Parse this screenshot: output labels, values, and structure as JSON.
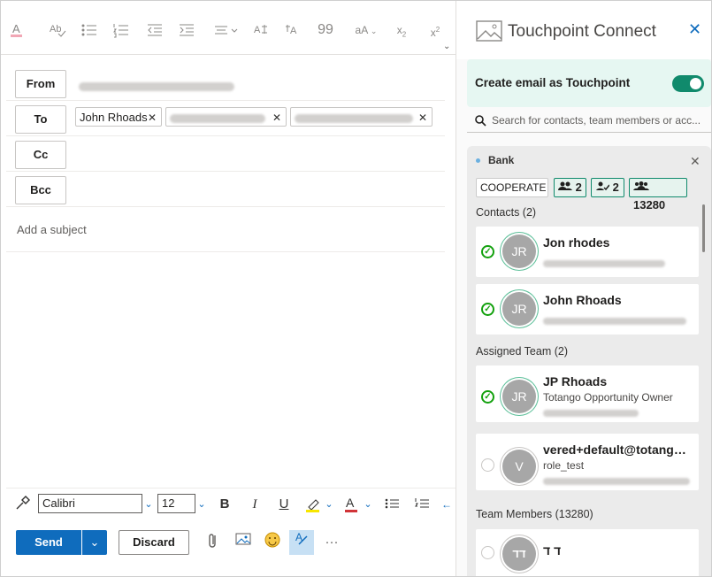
{
  "compose": {
    "from_label": "From",
    "to_label": "To",
    "cc_label": "Cc",
    "bcc_label": "Bcc",
    "to_recipients": [
      "John Rhoads",
      "",
      ""
    ],
    "subject_placeholder": "Add a subject",
    "format": {
      "font": "Calibri",
      "size": "12"
    },
    "send_label": "Send",
    "discard_label": "Discard",
    "more_label": "···"
  },
  "panel": {
    "title": "Touchpoint Connect",
    "toggle_label": "Create email as Touchpoint",
    "toggle_on": true,
    "search_placeholder": "Search for contacts, team members or acc...",
    "account": {
      "name": "Bank",
      "segment": "COOPERATE",
      "stat_contacts": "2",
      "stat_assigned": "2",
      "stat_team": "13280",
      "contacts_header": "Contacts (2)",
      "contacts": [
        {
          "initials": "JR",
          "name": "Jon rhodes",
          "subtitle": "",
          "checked": true
        },
        {
          "initials": "JR",
          "name": "John Rhoads",
          "subtitle": "",
          "checked": true
        }
      ],
      "assigned_header": "Assigned Team (2)",
      "assigned": [
        {
          "initials": "JR",
          "name": "JP Rhoads",
          "subtitle": "Totango Opportunity Owner",
          "checked": true
        },
        {
          "initials": "V",
          "name": "vered+default@totango...",
          "subtitle": "role_test",
          "checked": false
        }
      ],
      "team_header": "Team Members (13280)",
      "team": [
        {
          "initials": "דד",
          "name": "ד ד",
          "checked": false
        }
      ]
    }
  },
  "colors": {
    "accent": "#0f6cbd",
    "touchpoint_green": "#108a6c",
    "banner_bg": "#e6f7f2"
  }
}
